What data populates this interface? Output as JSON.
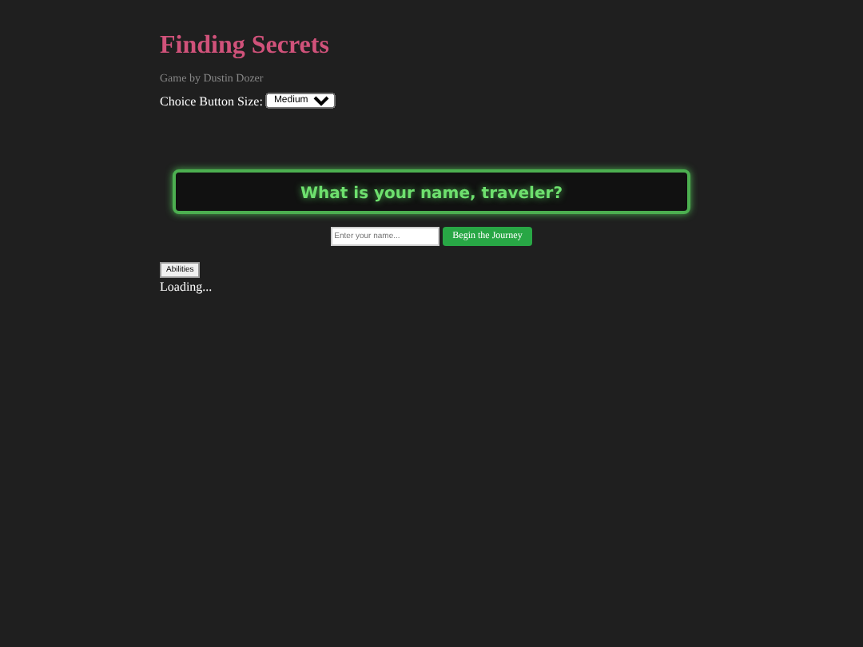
{
  "title": "Finding Secrets",
  "byline": "Game by Dustin Dozer",
  "size_control": {
    "label": "Choice Button Size:",
    "value": "Medium"
  },
  "prompt": "What is your name, traveler?",
  "name_field": {
    "placeholder": "Enter your name..."
  },
  "start_button": "Begin the Journey",
  "abilities_button": "Abilities",
  "status": "Loading..."
}
